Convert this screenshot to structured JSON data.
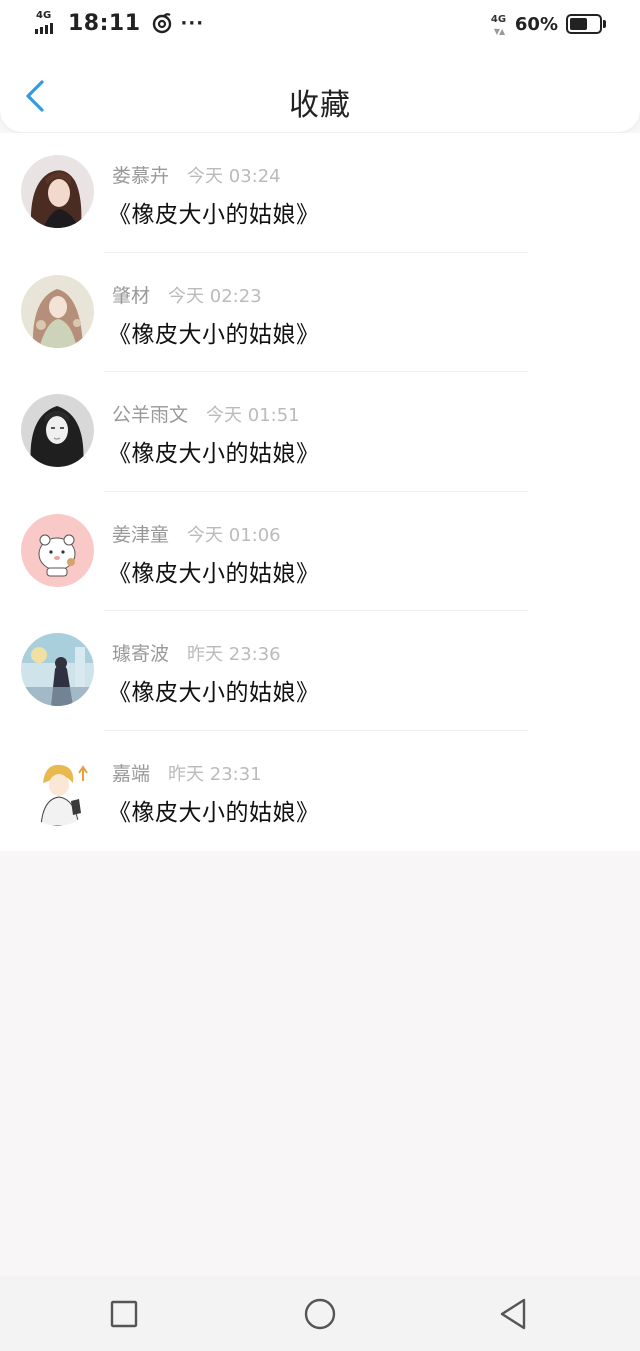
{
  "status_bar": {
    "network_left": "4G",
    "time": "18:11",
    "app_icon": "swirl-app-icon",
    "more": "···",
    "network_right": "4G",
    "battery": "60%",
    "battery_level": 0.6
  },
  "header": {
    "back_icon": "chevron-left-icon",
    "title": "收藏",
    "accent_color": "#2f9be6"
  },
  "favorites": [
    {
      "author": "娄慕卉",
      "time": "今天 03:24",
      "title": "《橡皮大小的姑娘》",
      "avatar_icon": "girl-photo-avatar"
    },
    {
      "author": "肇材",
      "time": "今天 02:23",
      "title": "《橡皮大小的姑娘》",
      "avatar_icon": "illustrated-girl-avatar"
    },
    {
      "author": "公羊雨文",
      "time": "今天 01:51",
      "title": "《橡皮大小的姑娘》",
      "avatar_icon": "bw-portrait-avatar"
    },
    {
      "author": "姜津童",
      "time": "今天 01:06",
      "title": "《橡皮大小的姑娘》",
      "avatar_icon": "cartoon-bear-avatar"
    },
    {
      "author": "璩寄波",
      "time": "昨天 23:36",
      "title": "《橡皮大小的姑娘》",
      "avatar_icon": "anime-scene-avatar"
    },
    {
      "author": "嘉端",
      "time": "昨天 23:31",
      "title": "《橡皮大小的姑娘》",
      "avatar_icon": "anime-boy-avatar"
    }
  ],
  "nav_bar": {
    "recent_icon": "square-recents-icon",
    "home_icon": "circle-home-icon",
    "back_icon": "triangle-back-icon"
  }
}
